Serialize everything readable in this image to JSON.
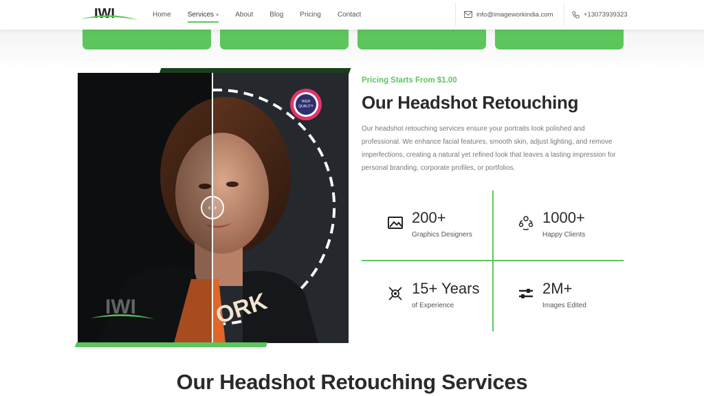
{
  "header": {
    "logo_text": "IWI",
    "nav": [
      {
        "label": "Home"
      },
      {
        "label": "Services",
        "caret": "˅"
      },
      {
        "label": "About"
      },
      {
        "label": "Blog"
      },
      {
        "label": "Pricing"
      },
      {
        "label": "Contact"
      }
    ],
    "email": "info@imageworkindia.com",
    "phone": "+13073939323"
  },
  "hero": {
    "image_overlay_text": "ORK",
    "badge_line1": "HIGH",
    "badge_line2": "QUALITY",
    "watermark_text": "IWI",
    "slider_handle": "‹ ›"
  },
  "content": {
    "pricing": "Pricing Starts From $1.00",
    "title": "Our Headshot Retouching",
    "description": "Our headshot retouching services ensure your portraits look polished and professional. We enhance facial features, smooth skin, adjust lighting, and remove imperfections, creating a natural yet refined look that leaves a lasting impression for personal branding, corporate profiles, or portfolios."
  },
  "stats": [
    {
      "value": "200+",
      "label": "Graphics Designers",
      "icon": "image-icon"
    },
    {
      "value": "1000+",
      "label": "Happy Clients",
      "icon": "users-icon"
    },
    {
      "value": "15+ Years",
      "label": "of Experience",
      "icon": "experience-icon"
    },
    {
      "value": "2M+",
      "label": "Images Edited",
      "icon": "sliders-icon"
    }
  ],
  "section_heading": "Our Headshot Retouching Services",
  "colors": {
    "accent": "#5cc65c",
    "dark_green": "#1b3f1d",
    "text": "#2a2a2a"
  }
}
